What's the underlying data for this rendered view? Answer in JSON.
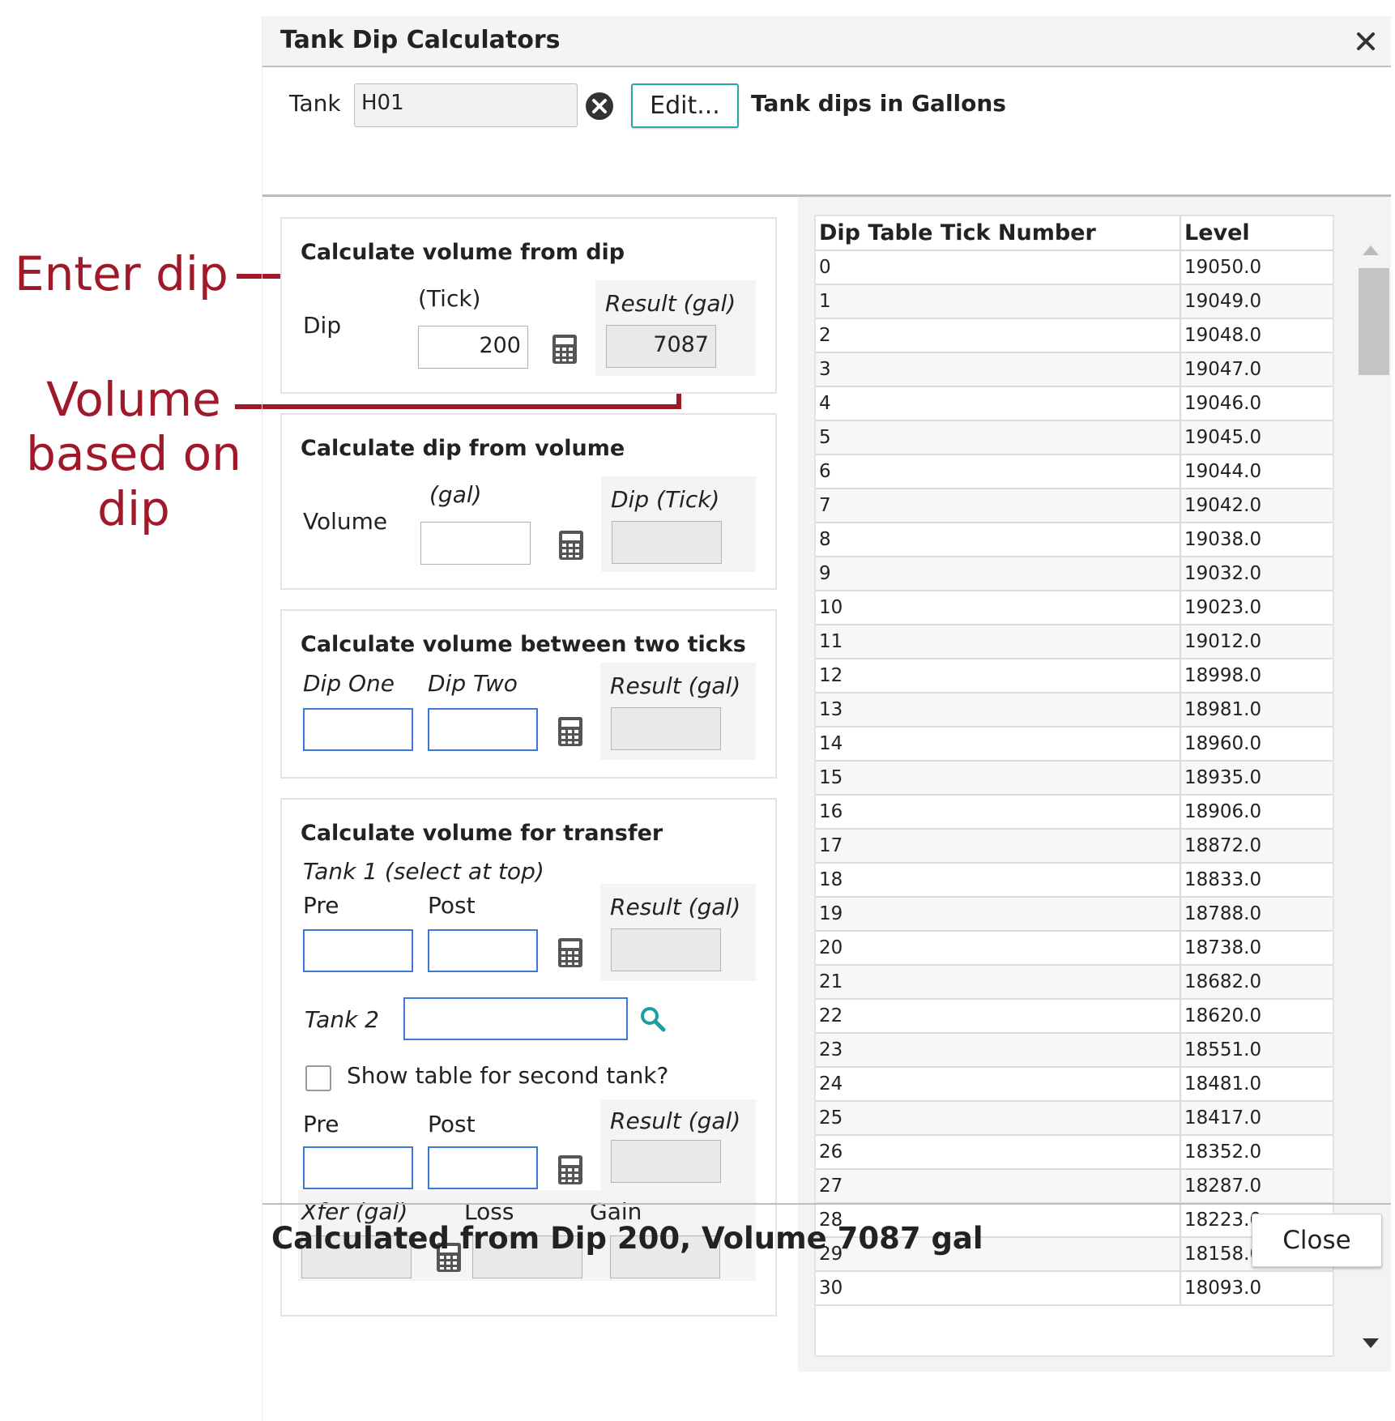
{
  "annotations": {
    "enter_dip": "Enter dip",
    "volume_based": "Volume based on dip"
  },
  "dialog": {
    "title": "Tank Dip Calculators"
  },
  "tank": {
    "label": "Tank",
    "value": "H01",
    "edit_label": "Edit...",
    "units_label": "Tank dips in Gallons"
  },
  "panel_vol_from_dip": {
    "title": "Calculate volume from dip",
    "dip_label": "Dip",
    "tick_label": "(Tick)",
    "dip_value": "200",
    "result_label": "Result (gal)",
    "result_value": "7087"
  },
  "panel_dip_from_vol": {
    "title": "Calculate dip from volume",
    "volume_label": "Volume",
    "gal_label": "(gal)",
    "volume_value": "",
    "result_label": "Dip (Tick)",
    "result_value": ""
  },
  "panel_between_ticks": {
    "title": "Calculate volume between two ticks",
    "dip_one_label": "Dip One",
    "dip_two_label": "Dip Two",
    "result_label": "Result (gal)"
  },
  "panel_transfer": {
    "title": "Calculate volume for transfer",
    "tank1_label": "Tank 1 (select at top)",
    "pre_label": "Pre",
    "post_label": "Post",
    "result_label": "Result (gal)",
    "tank2_label": "Tank 2",
    "tank2_value": "",
    "checkbox_label": "Show table for second tank?",
    "checkbox_checked": false,
    "pre2_label": "Pre",
    "post2_label": "Post",
    "result2_label": "Result (gal)",
    "xfer_label": "Xfer (gal)",
    "loss_label": "Loss",
    "gain_label": "Gain"
  },
  "dip_table": {
    "columns": [
      "Dip Table Tick Number",
      "Level"
    ],
    "rows": [
      [
        "0",
        "19050.0"
      ],
      [
        "1",
        "19049.0"
      ],
      [
        "2",
        "19048.0"
      ],
      [
        "3",
        "19047.0"
      ],
      [
        "4",
        "19046.0"
      ],
      [
        "5",
        "19045.0"
      ],
      [
        "6",
        "19044.0"
      ],
      [
        "7",
        "19042.0"
      ],
      [
        "8",
        "19038.0"
      ],
      [
        "9",
        "19032.0"
      ],
      [
        "10",
        "19023.0"
      ],
      [
        "11",
        "19012.0"
      ],
      [
        "12",
        "18998.0"
      ],
      [
        "13",
        "18981.0"
      ],
      [
        "14",
        "18960.0"
      ],
      [
        "15",
        "18935.0"
      ],
      [
        "16",
        "18906.0"
      ],
      [
        "17",
        "18872.0"
      ],
      [
        "18",
        "18833.0"
      ],
      [
        "19",
        "18788.0"
      ],
      [
        "20",
        "18738.0"
      ],
      [
        "21",
        "18682.0"
      ],
      [
        "22",
        "18620.0"
      ],
      [
        "23",
        "18551.0"
      ],
      [
        "24",
        "18481.0"
      ],
      [
        "25",
        "18417.0"
      ],
      [
        "26",
        "18352.0"
      ],
      [
        "27",
        "18287.0"
      ],
      [
        "28",
        "18223.0"
      ],
      [
        "29",
        "18158.0"
      ],
      [
        "30",
        "18093.0"
      ]
    ]
  },
  "footer": {
    "status": "Calculated from Dip 200, Volume 7087 gal",
    "close_label": "Close"
  },
  "colors": {
    "annotation": "#a0192a",
    "accent": "#2aa6a6",
    "focus_border": "#3b78d8"
  },
  "icons": {
    "close": "close-icon",
    "clear": "clear-icon",
    "calculator": "calculator-icon",
    "search": "search-icon"
  }
}
